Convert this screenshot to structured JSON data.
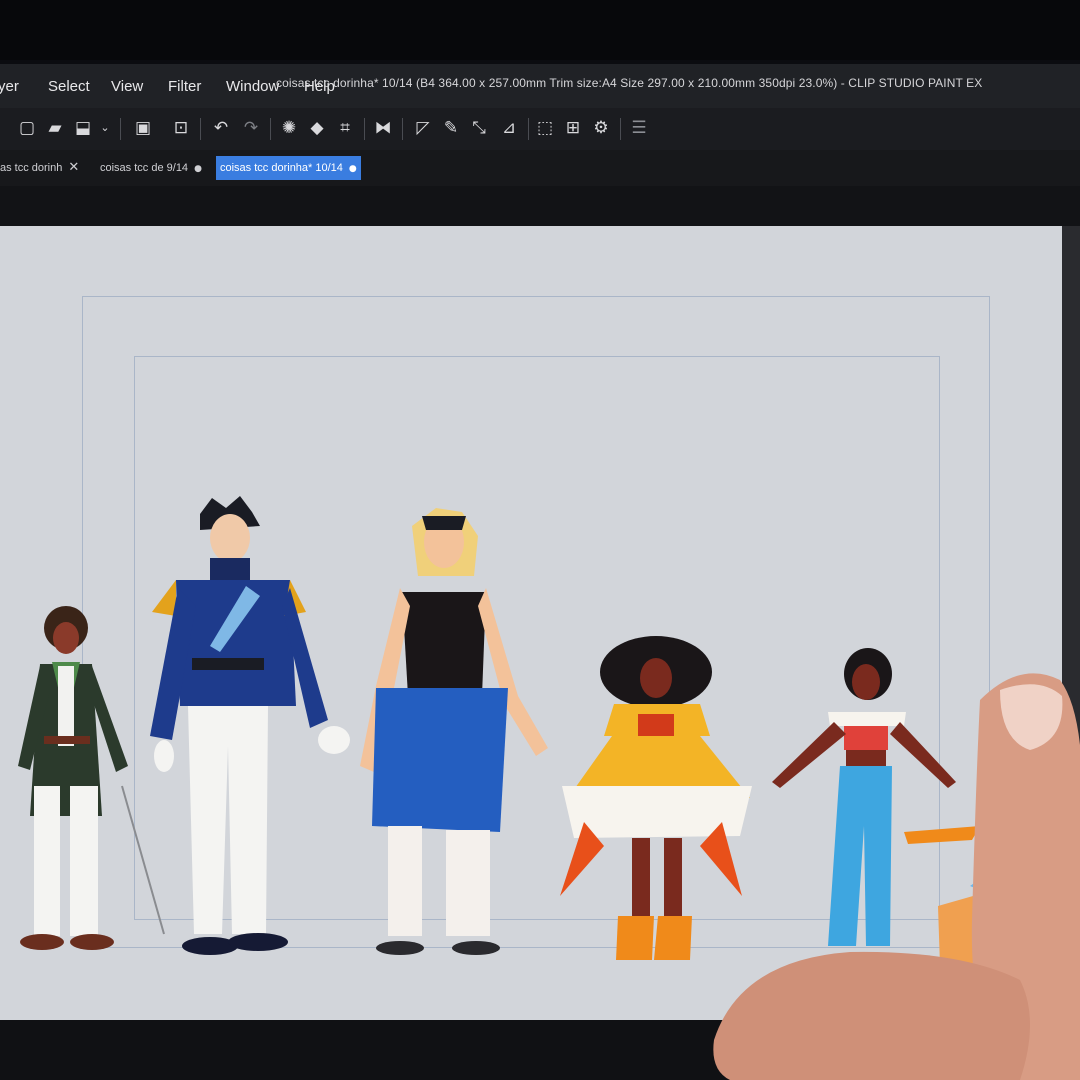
{
  "menu": {
    "items": [
      "yer",
      "Select",
      "View",
      "Filter",
      "Window",
      "Help"
    ]
  },
  "window": {
    "title": "coisas tcc dorinha* 10/14 (B4 364.00 x 257.00mm Trim size:A4 Size 297.00 x 210.00mm 350dpi 23.0%) - CLIP STUDIO PAINT EX"
  },
  "tabs": [
    {
      "label": "as tcc dorinh",
      "marker": "✕"
    },
    {
      "label": "coisas tcc de 9/14",
      "marker": "●"
    },
    {
      "label": "coisas tcc dorinha* 10/14",
      "marker": "●"
    }
  ],
  "toolbar": {
    "icons": [
      "new-layer-icon",
      "open-folder-icon",
      "save-icon",
      "dropdown-chevron-icon",
      "export-png-icon",
      "canvas-size-icon",
      "undo-icon",
      "redo-icon",
      "clear-selection-icon",
      "fill-icon",
      "crop-icon",
      "flip-horizontal-icon",
      "ruler-icon",
      "pen-ruler-icon",
      "perspective-icon",
      "line-ruler-icon",
      "frame-icon",
      "grid-icon",
      "brush-settings-icon",
      "layer-stack-icon"
    ]
  },
  "colors": {
    "accent": "#3a7de0",
    "canvas": "#d2d5da",
    "menubar": "#202226"
  }
}
